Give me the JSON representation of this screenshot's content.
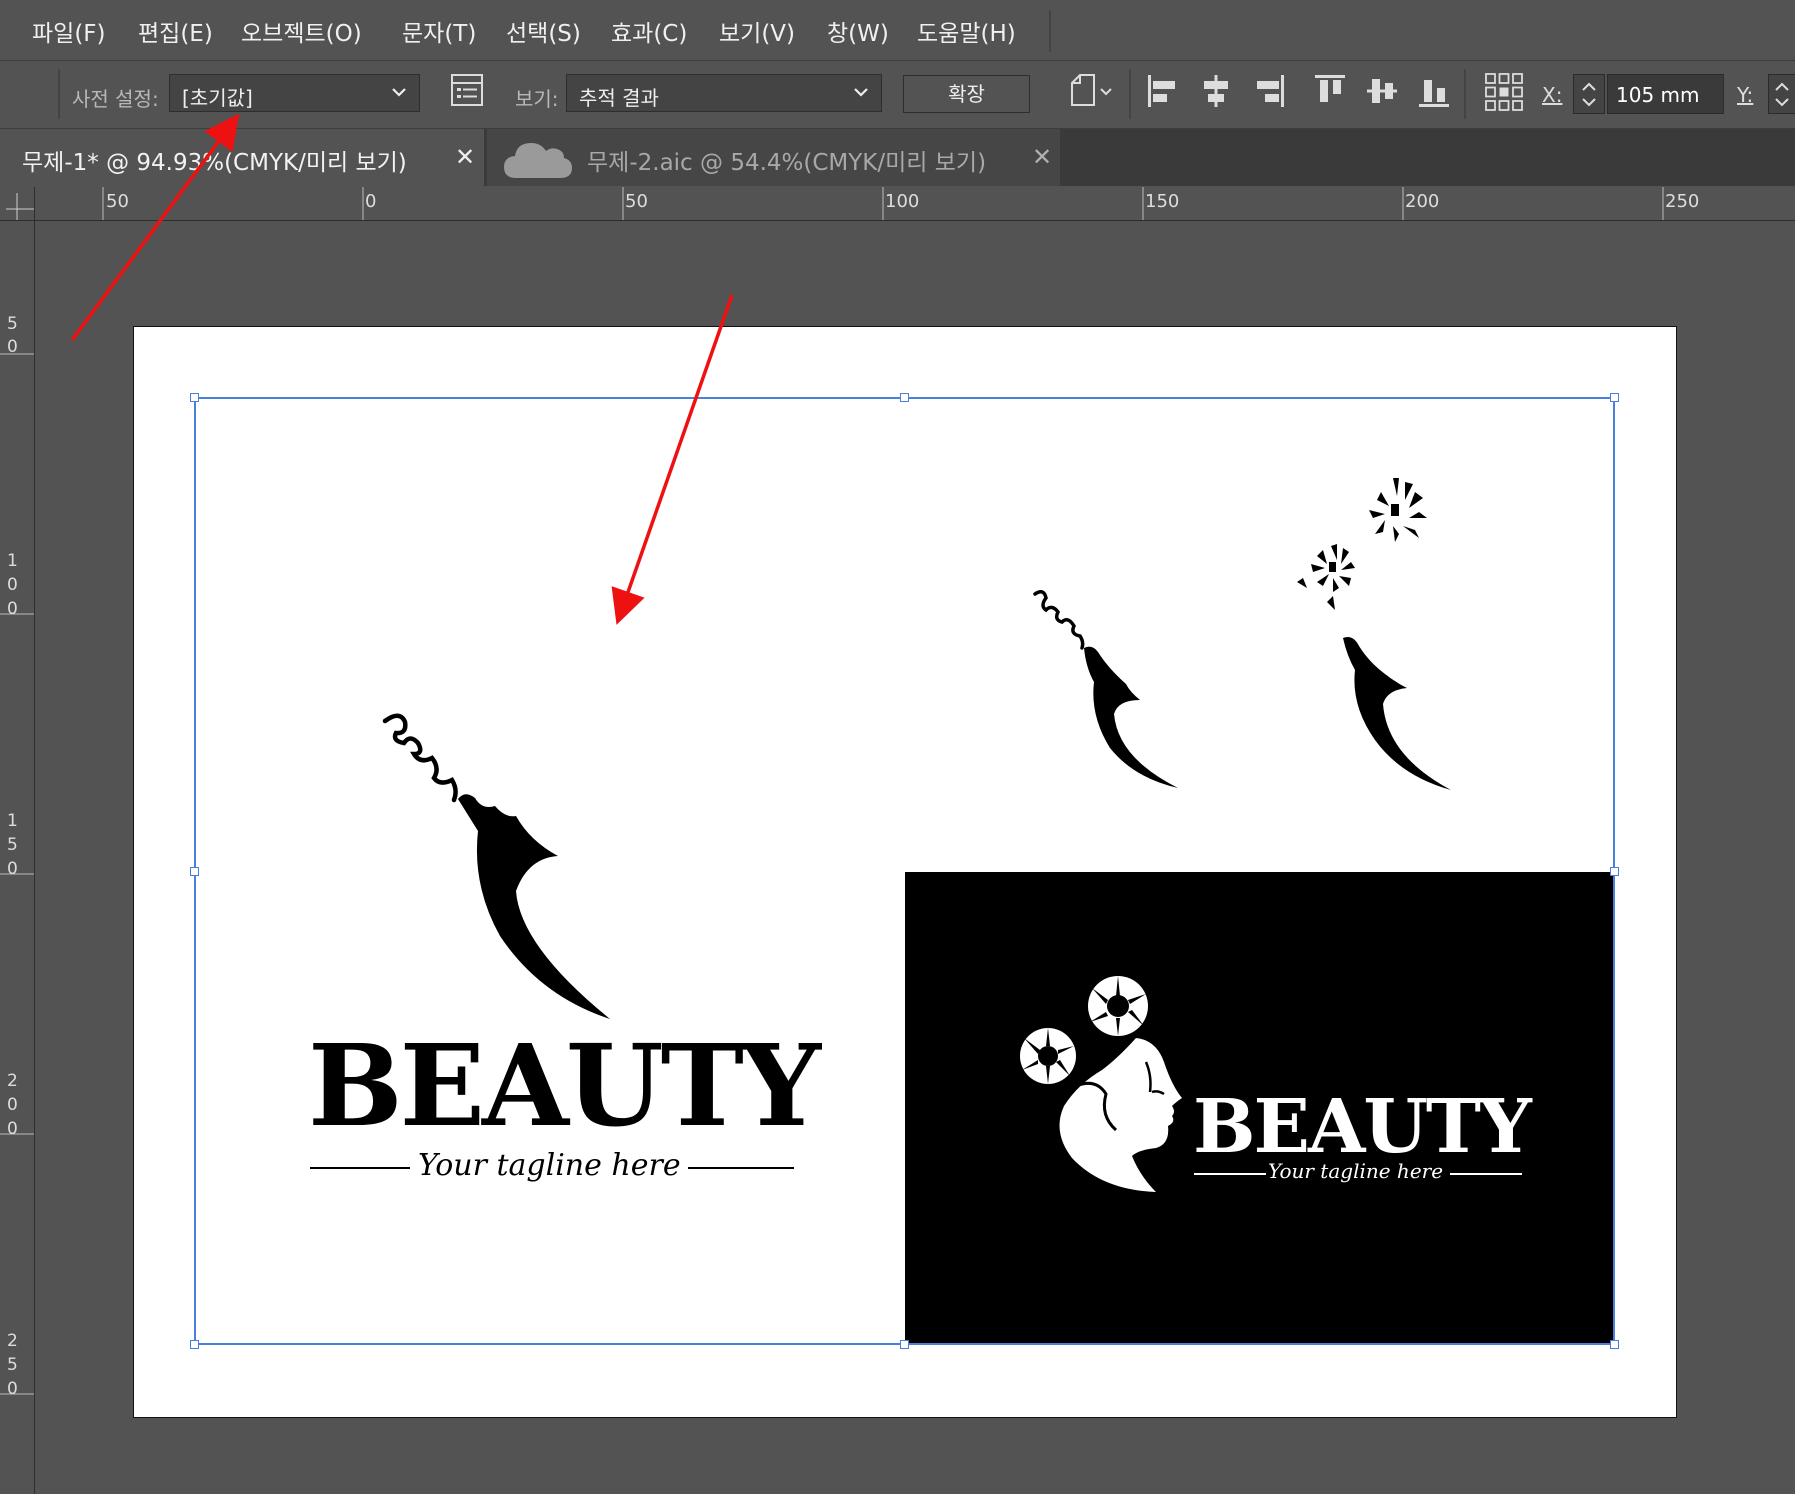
{
  "menu": {
    "items": [
      "파일(F)",
      "편집(E)",
      "오브젝트(O)",
      "문자(T)",
      "선택(S)",
      "효과(C)",
      "보기(V)",
      "창(W)",
      "도움말(H)"
    ]
  },
  "control_bar": {
    "preset_label": "사전 설정:",
    "preset_value": "[초기값]",
    "view_label": "보기:",
    "view_value": "추적 결과",
    "expand_button": "확장",
    "x_label": "X:",
    "x_value": "105 mm",
    "y_label": "Y:"
  },
  "tabs": [
    {
      "label": "무제-1* @ 94.93%(CMYK/미리 보기)",
      "active": true
    },
    {
      "label": "무제-2.aic @ 54.4%(CMYK/미리 보기)",
      "active": false
    }
  ],
  "horizontal_ruler": [
    "50",
    "0",
    "50",
    "100",
    "150",
    "200",
    "250"
  ],
  "vertical_ruler": [
    "50",
    "100",
    "150",
    "200",
    "250"
  ],
  "artwork": {
    "logo_light": {
      "wordmark": "BEAUTY",
      "tagline": "Your tagline here"
    },
    "logo_dark": {
      "wordmark": "BEAUTY",
      "tagline": "Your tagline here"
    }
  },
  "colors": {
    "ui_background": "#535353",
    "selection": "#4a7fe0",
    "annotation_arrow": "#ee1111"
  }
}
